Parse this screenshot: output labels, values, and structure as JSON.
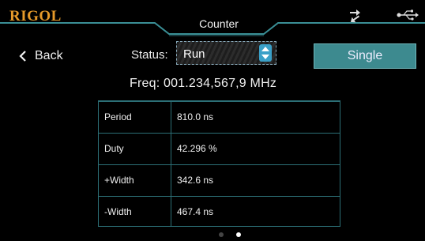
{
  "header": {
    "brand": "RIGOL",
    "title": "Counter",
    "accent_color": "#3a8f96",
    "brand_color": "#e69a2a"
  },
  "nav": {
    "back_label": "Back"
  },
  "status": {
    "label": "Status:",
    "value": "Run"
  },
  "actions": {
    "single_label": "Single"
  },
  "frequency": "Freq: 001.234,567,9 MHz",
  "measurements": [
    {
      "name": "Period",
      "value": "810.0 ns"
    },
    {
      "name": "Duty",
      "value": "42.296 %"
    },
    {
      "name": "+Width",
      "value": "342.6 ns"
    },
    {
      "name": "-Width",
      "value": "467.4 ns"
    }
  ],
  "pager": {
    "pages": 2,
    "active_page": 2
  }
}
